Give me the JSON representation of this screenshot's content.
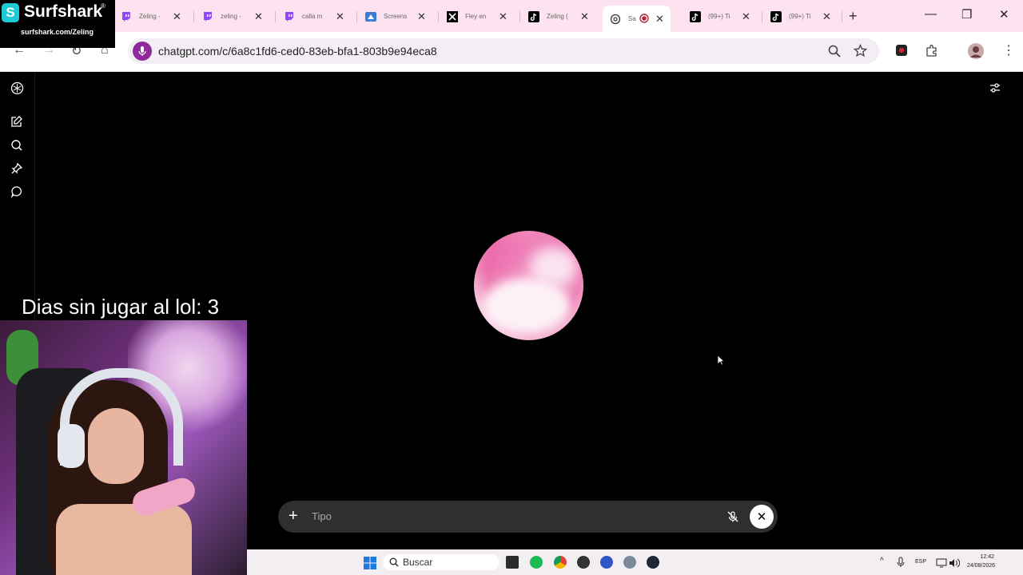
{
  "browser": {
    "tabs": [
      {
        "title": "Zeling -",
        "icon": "twitch-icon"
      },
      {
        "title": "zeling -",
        "icon": "twitch-icon"
      },
      {
        "title": "calla m",
        "icon": "twitch-icon"
      },
      {
        "title": "Screens",
        "icon": "screencast-icon"
      },
      {
        "title": "Fley en",
        "icon": "x-icon"
      },
      {
        "title": "Zeling (",
        "icon": "tiktok-icon"
      },
      {
        "title": "Sa",
        "icon": "chatgpt-icon",
        "active": true
      },
      {
        "title": "(99+) Ti",
        "icon": "tiktok-icon"
      },
      {
        "title": "(99+) Ti",
        "icon": "tiktok-icon"
      }
    ],
    "url": "chatgpt.com/c/6a8c1fd6-ced0-83eb-bfa1-803b9e94eca8"
  },
  "surfshark": {
    "name": "Surfshark",
    "reg": "®",
    "url": "surfshark.com/Zeling"
  },
  "chat": {
    "input_placeholder": "Tipo"
  },
  "overlay": {
    "counter": "Dias sin jugar al lol: 3"
  },
  "taskbar": {
    "search_label": "Buscar",
    "lang": "ESP",
    "time": "12:42",
    "date": "24/08/2026"
  },
  "colors": {
    "tabstrip": "#fde3ef",
    "orb_pink": "#ee86b8",
    "input_bg": "#2f2f2f",
    "surfshark_teal": "#1ecad3"
  }
}
